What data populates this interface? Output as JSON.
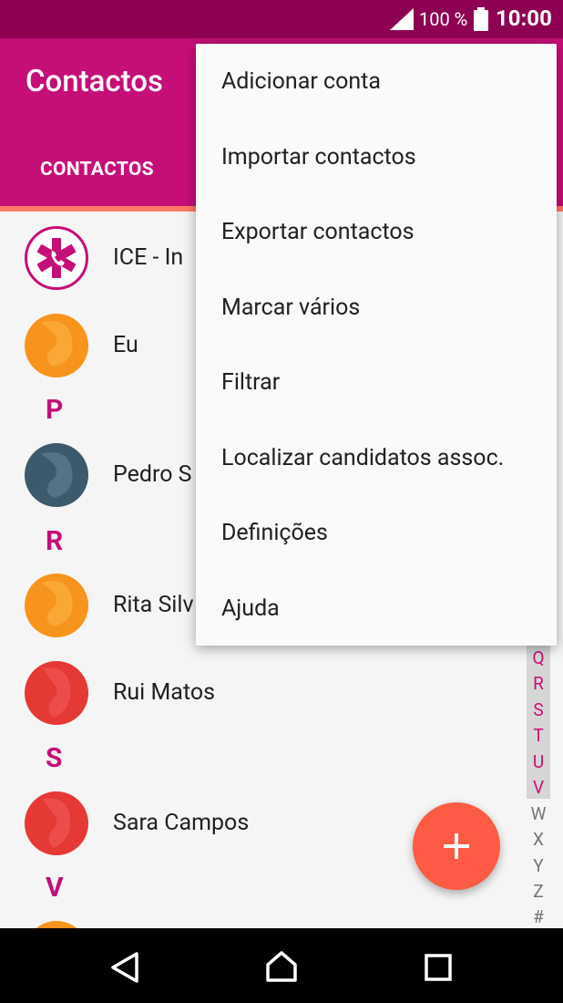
{
  "status_bar": {
    "battery_percent": "100 %",
    "time": "10:00"
  },
  "app_bar": {
    "title": "Contactos",
    "tab_label": "CONTACTOS"
  },
  "contacts": {
    "ice": "ICE - In",
    "me": "Eu",
    "section_p": "P",
    "pedro": "Pedro S",
    "section_r": "R",
    "rita": "Rita Silv",
    "rui": "Rui Matos",
    "section_s": "S",
    "sara": "Sara Campos",
    "section_v": "V"
  },
  "alpha_index": [
    "Q",
    "R",
    "S",
    "T",
    "U",
    "V",
    "W",
    "X",
    "Y",
    "Z",
    "#"
  ],
  "overflow_menu": {
    "items": [
      "Adicionar conta",
      "Importar contactos",
      "Exportar contactos",
      "Marcar vários",
      "Filtrar",
      "Localizar candidatos assoc.",
      "Definições",
      "Ajuda"
    ]
  },
  "colors": {
    "status_bar": "#8e0052",
    "app_bar": "#c60e78",
    "tab_indicator": "#ff7a67",
    "accent": "#c60e78",
    "fab": "#ff5a43"
  },
  "icons": {
    "fab": "plus-icon",
    "nav_back": "back-triangle-icon",
    "nav_home": "home-icon",
    "nav_recents": "recents-square-icon"
  }
}
